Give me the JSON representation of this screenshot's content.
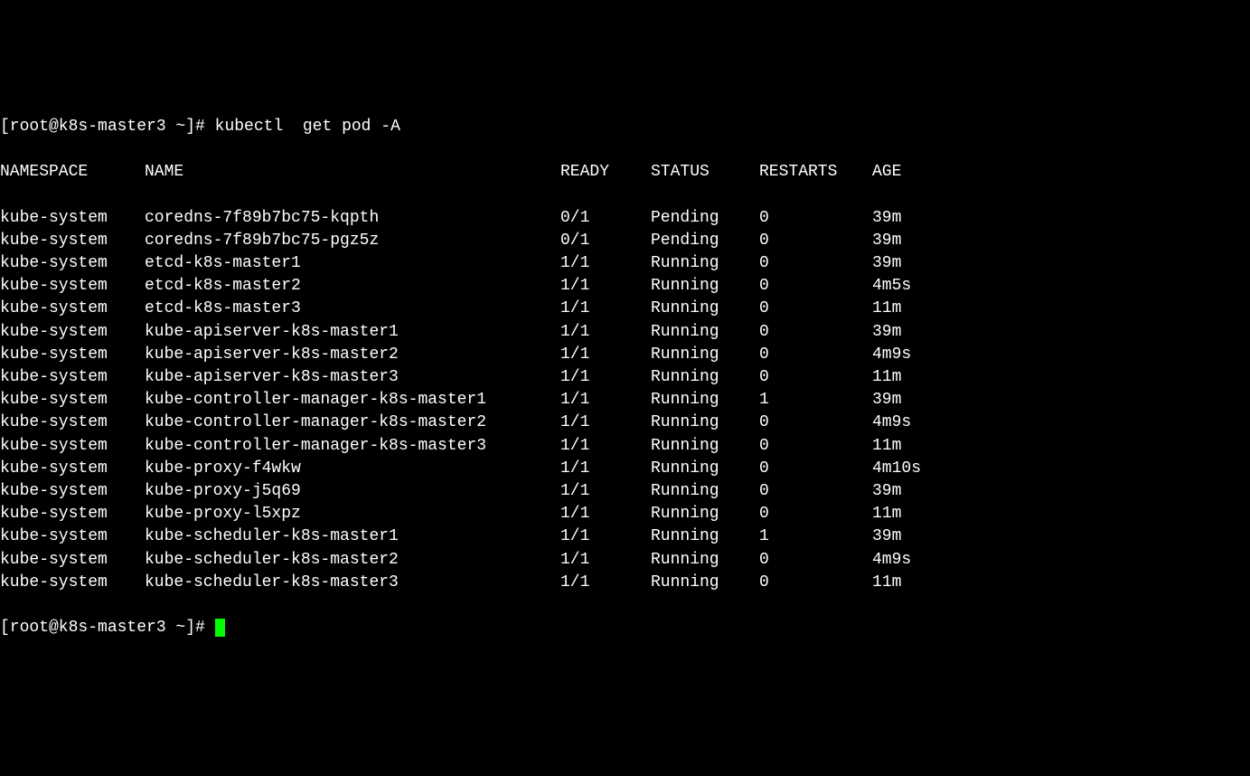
{
  "prompt1": {
    "user": "[root@k8s-master3 ~]# ",
    "command": "kubectl  get pod -A"
  },
  "headers": {
    "namespace": "NAMESPACE",
    "name": "NAME",
    "ready": "READY",
    "status": "STATUS",
    "restarts": "RESTARTS",
    "age": "AGE"
  },
  "rows": [
    {
      "namespace": "kube-system",
      "name": "coredns-7f89b7bc75-kqpth",
      "ready": "0/1",
      "status": "Pending",
      "restarts": "0",
      "age": "39m"
    },
    {
      "namespace": "kube-system",
      "name": "coredns-7f89b7bc75-pgz5z",
      "ready": "0/1",
      "status": "Pending",
      "restarts": "0",
      "age": "39m"
    },
    {
      "namespace": "kube-system",
      "name": "etcd-k8s-master1",
      "ready": "1/1",
      "status": "Running",
      "restarts": "0",
      "age": "39m"
    },
    {
      "namespace": "kube-system",
      "name": "etcd-k8s-master2",
      "ready": "1/1",
      "status": "Running",
      "restarts": "0",
      "age": "4m5s"
    },
    {
      "namespace": "kube-system",
      "name": "etcd-k8s-master3",
      "ready": "1/1",
      "status": "Running",
      "restarts": "0",
      "age": "11m"
    },
    {
      "namespace": "kube-system",
      "name": "kube-apiserver-k8s-master1",
      "ready": "1/1",
      "status": "Running",
      "restarts": "0",
      "age": "39m"
    },
    {
      "namespace": "kube-system",
      "name": "kube-apiserver-k8s-master2",
      "ready": "1/1",
      "status": "Running",
      "restarts": "0",
      "age": "4m9s"
    },
    {
      "namespace": "kube-system",
      "name": "kube-apiserver-k8s-master3",
      "ready": "1/1",
      "status": "Running",
      "restarts": "0",
      "age": "11m"
    },
    {
      "namespace": "kube-system",
      "name": "kube-controller-manager-k8s-master1",
      "ready": "1/1",
      "status": "Running",
      "restarts": "1",
      "age": "39m"
    },
    {
      "namespace": "kube-system",
      "name": "kube-controller-manager-k8s-master2",
      "ready": "1/1",
      "status": "Running",
      "restarts": "0",
      "age": "4m9s"
    },
    {
      "namespace": "kube-system",
      "name": "kube-controller-manager-k8s-master3",
      "ready": "1/1",
      "status": "Running",
      "restarts": "0",
      "age": "11m"
    },
    {
      "namespace": "kube-system",
      "name": "kube-proxy-f4wkw",
      "ready": "1/1",
      "status": "Running",
      "restarts": "0",
      "age": "4m10s"
    },
    {
      "namespace": "kube-system",
      "name": "kube-proxy-j5q69",
      "ready": "1/1",
      "status": "Running",
      "restarts": "0",
      "age": "39m"
    },
    {
      "namespace": "kube-system",
      "name": "kube-proxy-l5xpz",
      "ready": "1/1",
      "status": "Running",
      "restarts": "0",
      "age": "11m"
    },
    {
      "namespace": "kube-system",
      "name": "kube-scheduler-k8s-master1",
      "ready": "1/1",
      "status": "Running",
      "restarts": "1",
      "age": "39m"
    },
    {
      "namespace": "kube-system",
      "name": "kube-scheduler-k8s-master2",
      "ready": "1/1",
      "status": "Running",
      "restarts": "0",
      "age": "4m9s"
    },
    {
      "namespace": "kube-system",
      "name": "kube-scheduler-k8s-master3",
      "ready": "1/1",
      "status": "Running",
      "restarts": "0",
      "age": "11m"
    }
  ],
  "prompt2": {
    "user": "[root@k8s-master3 ~]# "
  }
}
